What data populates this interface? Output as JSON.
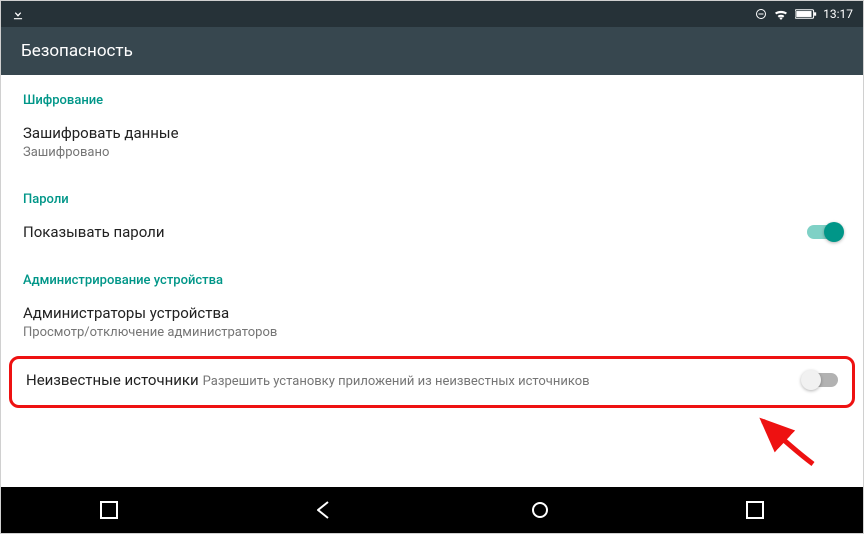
{
  "statusbar": {
    "time": "13:17"
  },
  "title": "Безопасность",
  "sections": {
    "encryption": {
      "header": "Шифрование",
      "encrypt_title": "Зашифровать данные",
      "encrypt_sub": "Зашифровано"
    },
    "passwords": {
      "header": "Пароли",
      "show_passwords": "Показывать пароли"
    },
    "admin": {
      "header": "Администрирование устройства",
      "admins_title": "Администраторы устройства",
      "admins_sub": "Просмотр/отключение администраторов",
      "unknown_title": "Неизвестные источники",
      "unknown_sub": "Разрешить установку приложений из неизвестных источников"
    }
  }
}
